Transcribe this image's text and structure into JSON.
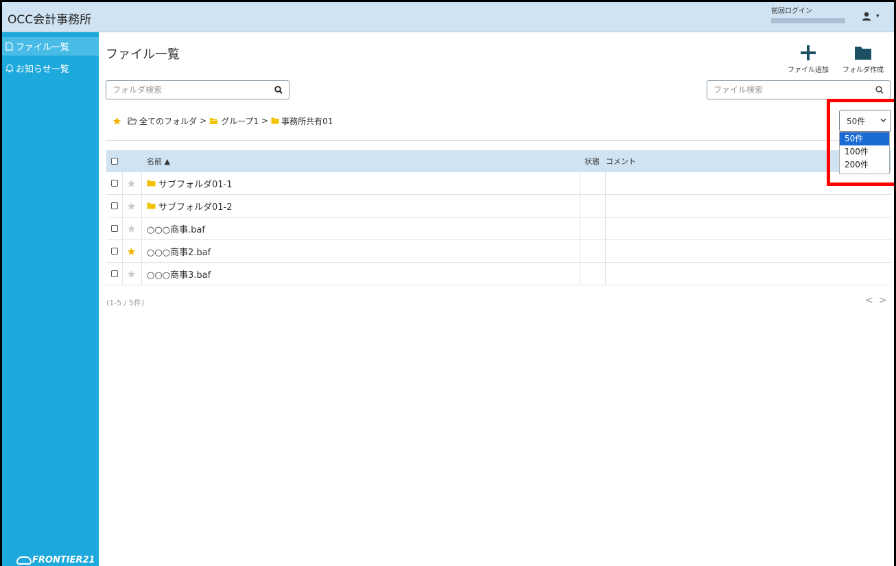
{
  "header": {
    "app_title": "OCC会計事務所",
    "last_login_label": "前回ログイン"
  },
  "sidebar": {
    "items": [
      {
        "label": "ファイル一覧",
        "icon": "file-icon",
        "active": true
      },
      {
        "label": "お知らせ一覧",
        "icon": "bell-icon",
        "active": false
      }
    ],
    "logo_text": "FRONTIER21"
  },
  "main": {
    "title": "ファイル一覧",
    "actions": {
      "add_file_label": "ファイル追加",
      "create_folder_label": "フォルダ作成"
    },
    "folder_search": {
      "placeholder": "フォルダ検索"
    },
    "file_search": {
      "placeholder": "ファイル検索"
    },
    "breadcrumb": {
      "sep": ">",
      "items": [
        "全てのフォルダ",
        "グループ1",
        "事務所共有01"
      ]
    },
    "page_size": {
      "selected": "50件",
      "options": [
        "50件",
        "100件",
        "200件"
      ]
    },
    "table": {
      "headers": {
        "name": "名前 ▲",
        "status": "状態",
        "comment": "コメント"
      },
      "rows": [
        {
          "name": "サブフォルダ01-1",
          "type": "folder",
          "starred": false
        },
        {
          "name": "サブフォルダ01-2",
          "type": "folder",
          "starred": false
        },
        {
          "name": "○○○商事.baf",
          "type": "file",
          "starred": false
        },
        {
          "name": "○○○商事2.baf",
          "type": "file",
          "starred": true
        },
        {
          "name": "○○○商事3.baf",
          "type": "file",
          "starred": false
        }
      ]
    },
    "count_text": "(1-5 / 5件)",
    "pager": {
      "prev": "<",
      "next": ">"
    }
  },
  "colors": {
    "sidebar_bg": "#1ea9dc",
    "header_bg": "#cfe3f3",
    "folder_yellow": "#f2c200",
    "star_gold": "#f2b400",
    "star_gray": "#cccccc",
    "highlight_red": "#ff0000",
    "action_icon": "#1d4f63"
  }
}
